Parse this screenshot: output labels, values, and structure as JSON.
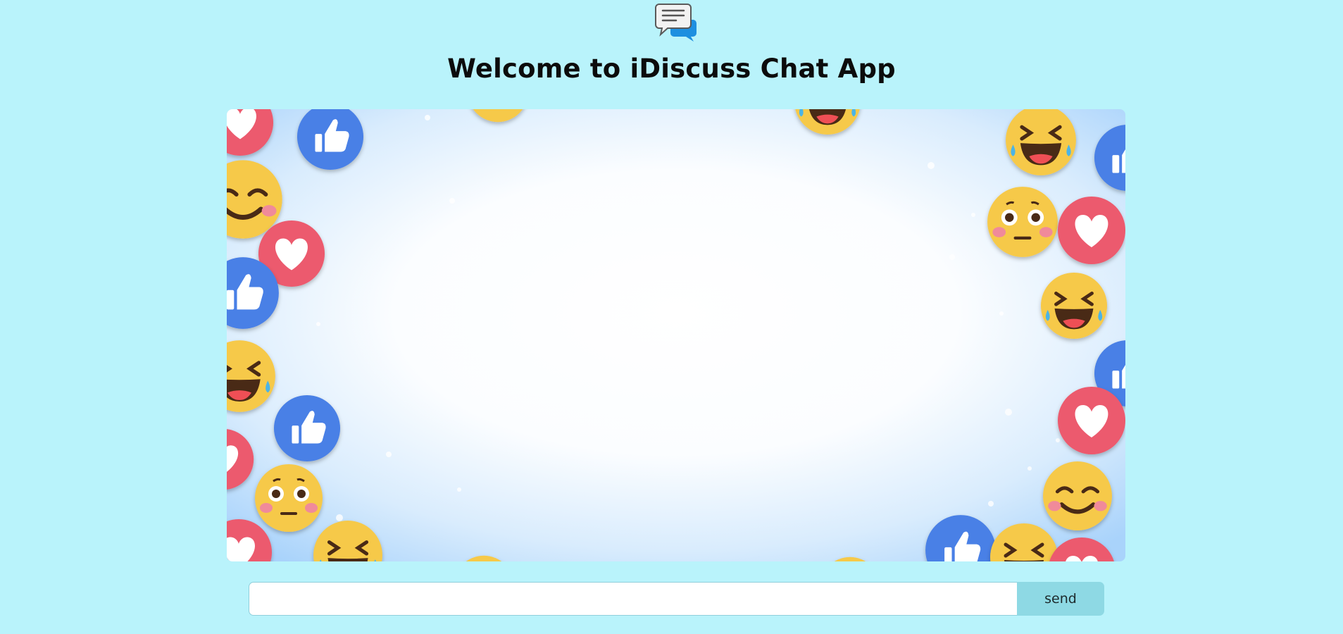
{
  "header": {
    "title": "Welcome to iDiscuss Chat App",
    "logo_icon": "chat-bubbles-icon"
  },
  "chat": {
    "background": "emoji-reactions-frame",
    "messages": []
  },
  "composer": {
    "input_value": "",
    "placeholder": "",
    "send_label": "send"
  },
  "colors": {
    "page_bg": "#b9f3fb",
    "send_bg": "#8ed9e4",
    "like_blue": "#4a80e6",
    "heart_red": "#ec5a6e",
    "emoji_yellow": "#f6c94a"
  }
}
